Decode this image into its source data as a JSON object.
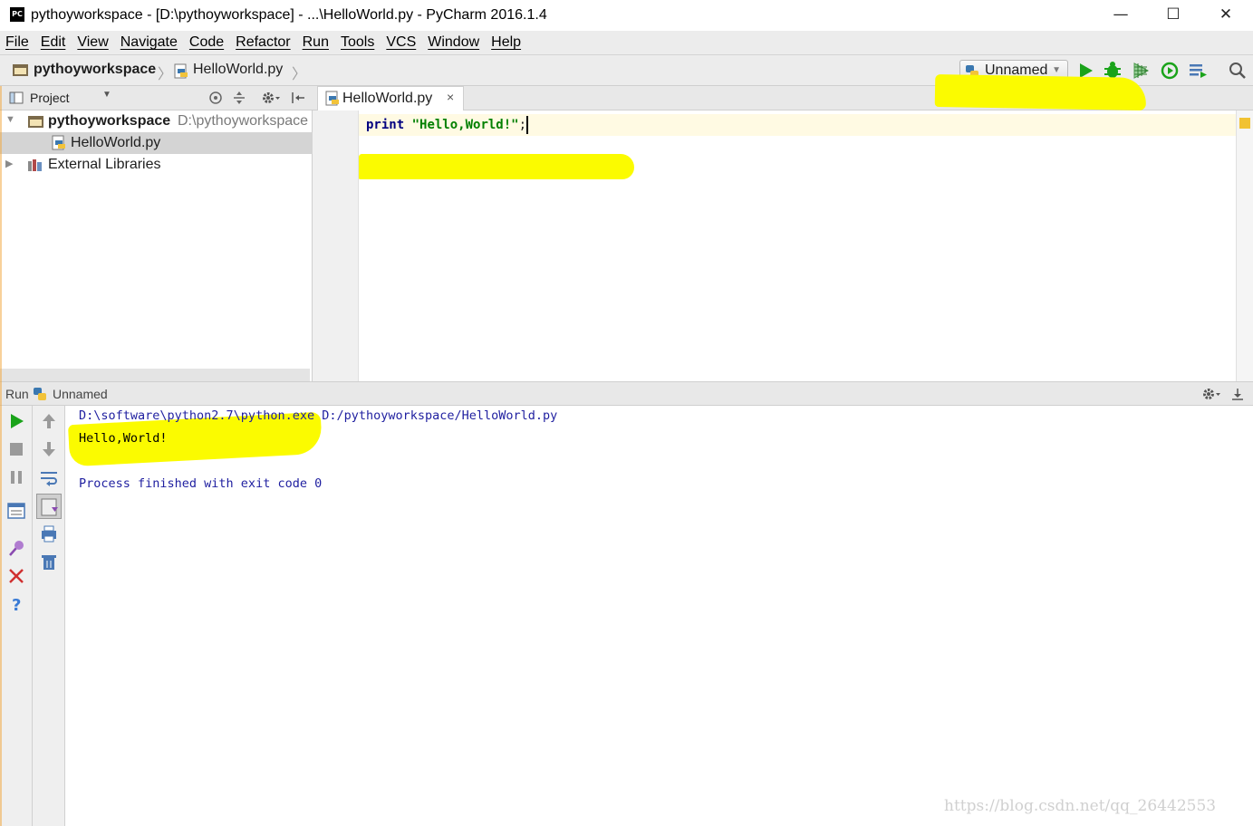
{
  "window": {
    "title": "pythoyworkspace - [D:\\pythoyworkspace] - ...\\HelloWorld.py - PyCharm 2016.1.4",
    "logo": "PC",
    "controls": {
      "minimize": "—",
      "maximize": "☐",
      "close": "✕"
    }
  },
  "menubar": {
    "items": [
      "File",
      "Edit",
      "View",
      "Navigate",
      "Code",
      "Refactor",
      "Run",
      "Tools",
      "VCS",
      "Window",
      "Help"
    ]
  },
  "navbar": {
    "project": "pythoyworkspace",
    "separator": "〉",
    "file": "HelloWorld.py",
    "run_config": "Unnamed",
    "run_config_caret": "▼",
    "icons": [
      "run-icon",
      "debug-icon",
      "coverage-icon",
      "profile-icon",
      "tasks-icon",
      "search-icon"
    ]
  },
  "project_panel": {
    "header_label": "Project",
    "header_caret": "▼",
    "tree": [
      {
        "label": "pythoyworkspace",
        "path": "D:\\pythoyworkspace",
        "expanded": true,
        "arrow": "▼"
      },
      {
        "label": "HelloWorld.py"
      },
      {
        "label": "External Libraries",
        "arrow": "▶"
      }
    ]
  },
  "editor": {
    "tab_label": "HelloWorld.py",
    "tab_close": "×",
    "code": {
      "keyword": "print",
      "string": "\"Hello,World!\"",
      "suffix": ";"
    }
  },
  "run_panel": {
    "label": "Run",
    "config": "Unnamed",
    "console": {
      "command": "D:\\software\\python2.7\\python.exe D:/pythoyworkspace/HelloWorld.py",
      "output": "Hello,World!",
      "process": "Process finished with exit code 0"
    }
  },
  "watermark": "https://blog.csdn.net/qq_26442553",
  "colors": {
    "highlight": "#fbfb00",
    "run_green": "#1aa31a",
    "keyword": "#000080",
    "string": "#008000"
  }
}
